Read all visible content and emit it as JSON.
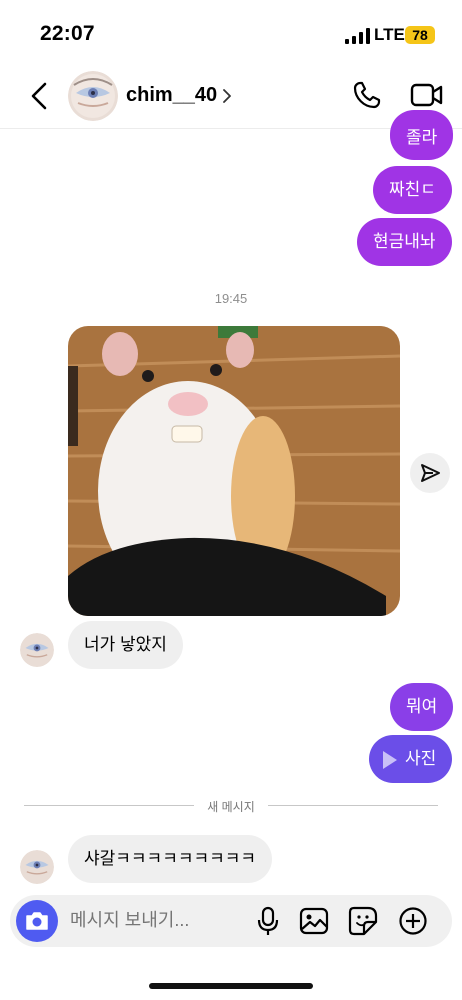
{
  "status_bar": {
    "time": "22:07",
    "network": "LTE",
    "battery": "78"
  },
  "header": {
    "username": "chim__40",
    "icons": [
      "back-chevron-icon",
      "avatar",
      "chevron-right-icon",
      "phone-icon",
      "video-camera-icon"
    ]
  },
  "messages": {
    "out1": "졸라",
    "out2": "짜친ㄷ",
    "out3": "현금내놔",
    "timestamp": "19:45",
    "in1": "너가 낳았지",
    "out4": "뭐여",
    "out5_label": "사진",
    "new_messages_divider": "새 메시지",
    "in2": "샤갈ㅋㅋㅋㅋㅋㅋㅋㅋㅋ"
  },
  "composer": {
    "placeholder": "메시지 보내기...",
    "icons": [
      "camera-icon",
      "microphone-icon",
      "gallery-icon",
      "sticker-icon",
      "add-icon"
    ]
  },
  "colors": {
    "outgoing_bubble": "#a034e5",
    "outgoing_bubble_alt": "#6b4ee8",
    "incoming_bubble": "#efefef",
    "camera_button": "#4f5bf1",
    "battery": "#f5c518"
  }
}
